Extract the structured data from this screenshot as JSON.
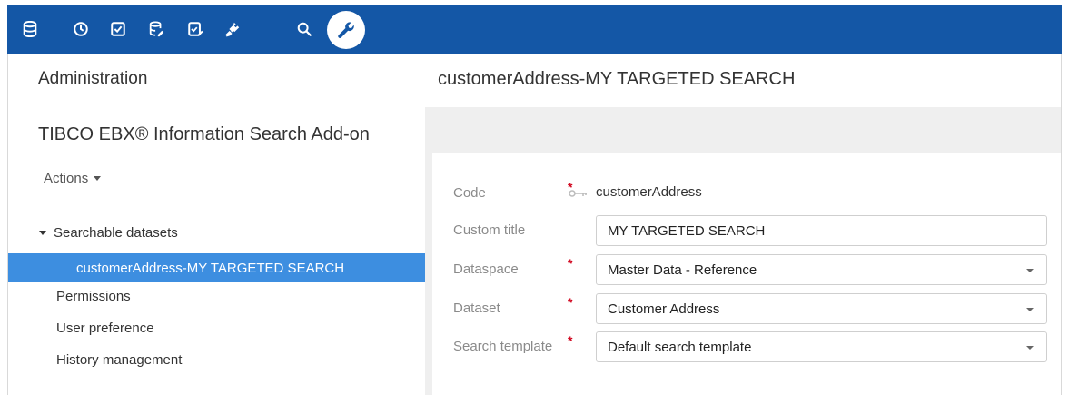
{
  "toolbar": {
    "icons": [
      "database-icon",
      "history-icon",
      "task-check-icon",
      "dataset-edit-icon",
      "validation-icon",
      "plugin-icon",
      "search-icon",
      "wrench-icon"
    ],
    "active_color": "#1457a6"
  },
  "left": {
    "admin_title": "Administration",
    "ebx_title": "TIBCO EBX® Information Search Add-on",
    "actions_label": "Actions",
    "tree": {
      "group_label": "Searchable datasets",
      "selected_item": "customerAddress-MY TARGETED SEARCH",
      "items": [
        "Permissions",
        "User preference",
        "History management"
      ]
    }
  },
  "main": {
    "title": "customerAddress-MY TARGETED SEARCH",
    "form": {
      "code_label": "Code",
      "code_value": "customerAddress",
      "custom_title_label": "Custom title",
      "custom_title_value": "MY TARGETED SEARCH",
      "dataspace_label": "Dataspace",
      "dataspace_value": "Master Data - Reference",
      "dataset_label": "Dataset",
      "dataset_value": "Customer Address",
      "search_template_label": "Search template",
      "search_template_value": "Default search template",
      "required_mark": "*"
    }
  },
  "colors": {
    "toolbar_bg": "#1457a6",
    "selection_bg": "#3d8ee0",
    "required": "#d0021b"
  }
}
